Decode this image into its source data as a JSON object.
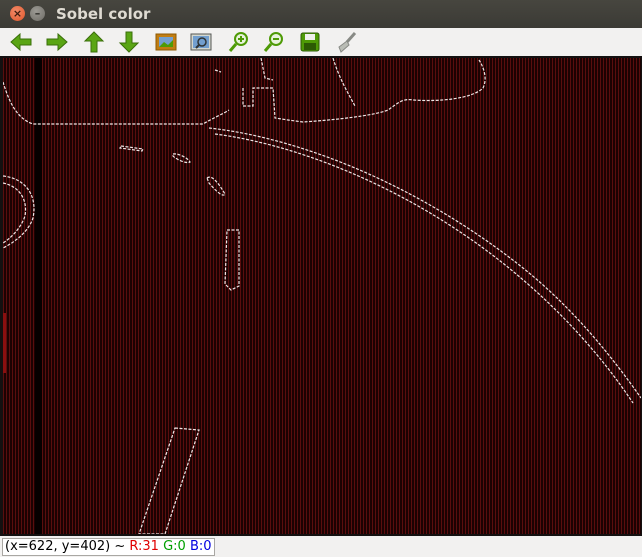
{
  "window": {
    "title": "Sobel color",
    "close_symbol": "×",
    "minimize_symbol": "–"
  },
  "toolbar": {
    "items": [
      {
        "icon": "arrow-left-icon",
        "color": "#4e9a06"
      },
      {
        "icon": "arrow-right-icon",
        "color": "#4e9a06"
      },
      {
        "icon": "arrow-up-icon",
        "color": "#4e9a06"
      },
      {
        "icon": "arrow-down-icon",
        "color": "#4e9a06"
      },
      {
        "icon": "image-icon",
        "color": "#c17d11"
      },
      {
        "icon": "zoom-fit-icon",
        "color": "#3465a4"
      },
      {
        "icon": "zoom-in-icon",
        "color": "#4e9a06"
      },
      {
        "icon": "zoom-out-icon",
        "color": "#4e9a06"
      },
      {
        "icon": "save-icon",
        "color": "#4e9a06"
      },
      {
        "icon": "brush-icon",
        "color": "#888a85"
      }
    ]
  },
  "status": {
    "coords": "(x=622, y=402) ~",
    "r": "R:31",
    "g": "G:0",
    "b": "B:0"
  },
  "colors": {
    "edge_line": "#f0e6e6",
    "background_red": "#5a0e0e",
    "r_text": "#e00000",
    "g_text": "#00a000",
    "b_text": "#0000e0"
  }
}
